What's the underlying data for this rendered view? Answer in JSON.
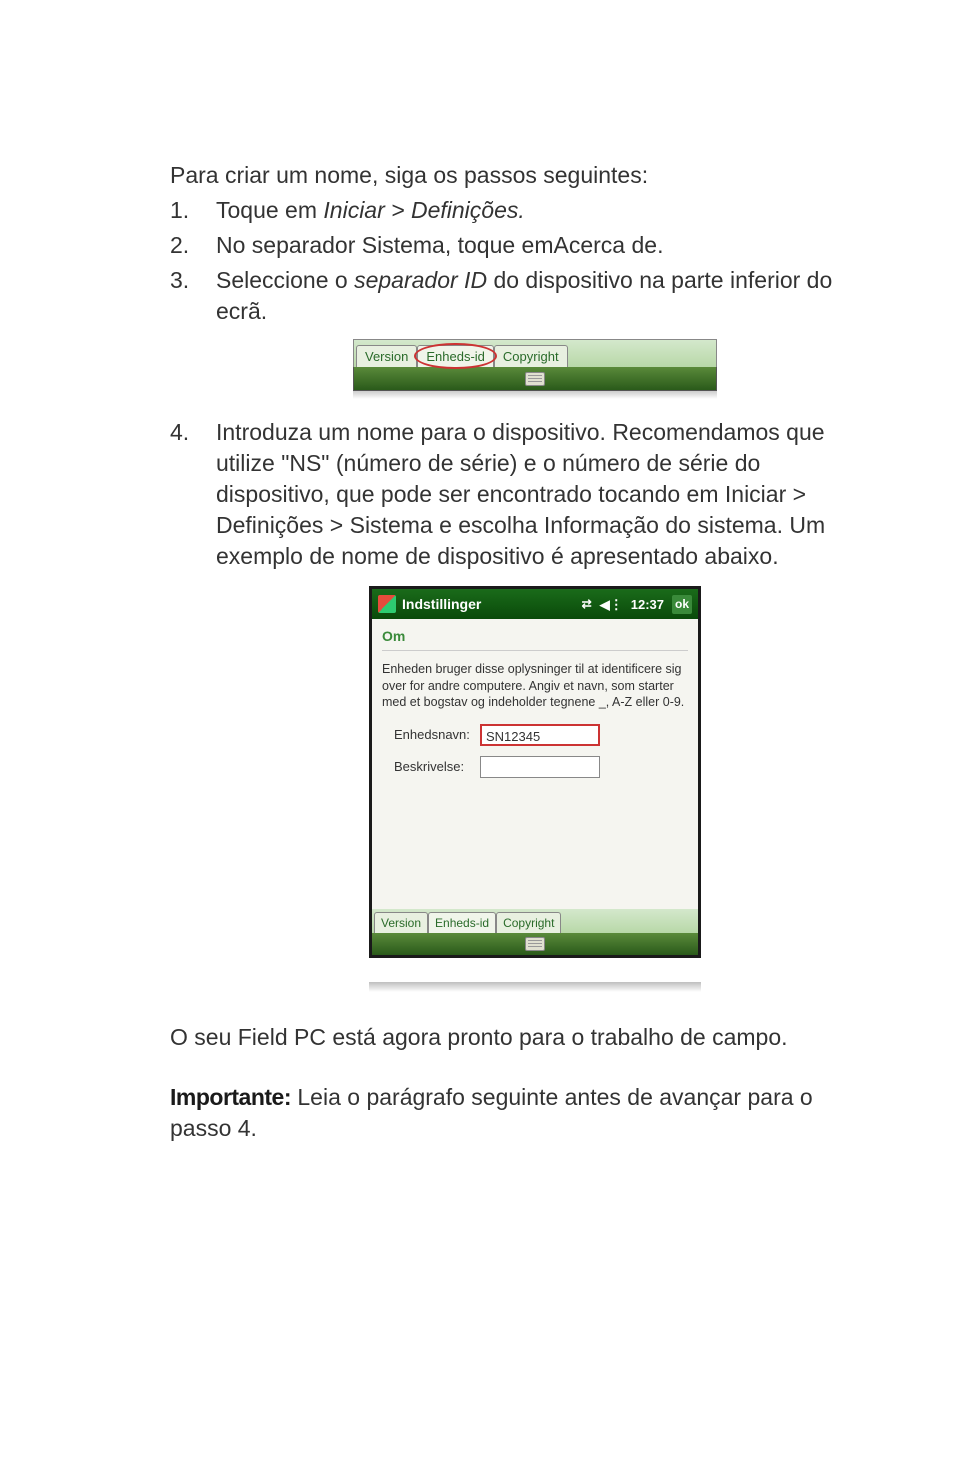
{
  "intro": "Para criar um nome, siga os passos seguintes:",
  "steps": {
    "s1_prefix": "Toque em ",
    "s1_italic": "Iniciar > Definições.",
    "s2_prefix": "No separador Sistema, toque em",
    "s2_semi": "Acerca de.",
    "s3_prefix": "Seleccione o ",
    "s3_italic": "separador ID",
    "s3_suffix": " do dispositivo na parte inferior do ecrã.",
    "s4": "Introduza um nome para o dispositivo. Recomendamos que utilize \"NS\" (número de série) e o número de série do dispositivo, que pode ser encontrado tocando em Iniciar > Definições > Sistema e escolha Informação do sistema. Um exemplo de nome de dispositivo é apresentado abaixo."
  },
  "tabs_img": {
    "version": "Version",
    "enheds": "Enheds-id",
    "copyright": "Copyright"
  },
  "settings_img": {
    "title": "Indstillinger",
    "time": "12:37",
    "ok": "ok",
    "section": "Om",
    "desc": "Enheden bruger disse oplysninger til at identificere sig over for andre computere. Angiv et navn, som starter med et bogstav og indeholder tegnene _, A-Z eller 0-9.",
    "field1_label": "Enhedsnavn:",
    "field1_value": "SN12345",
    "field2_label": "Beskrivelse:",
    "field2_value": "",
    "tab_version": "Version",
    "tab_enheds": "Enheds-id",
    "tab_copyright": "Copyright"
  },
  "closing": "O seu Field PC está agora pronto para o trabalho de campo.",
  "important_label": "Importante:",
  "important_text": " Leia o parágrafo seguinte antes de avançar para o passo 4."
}
